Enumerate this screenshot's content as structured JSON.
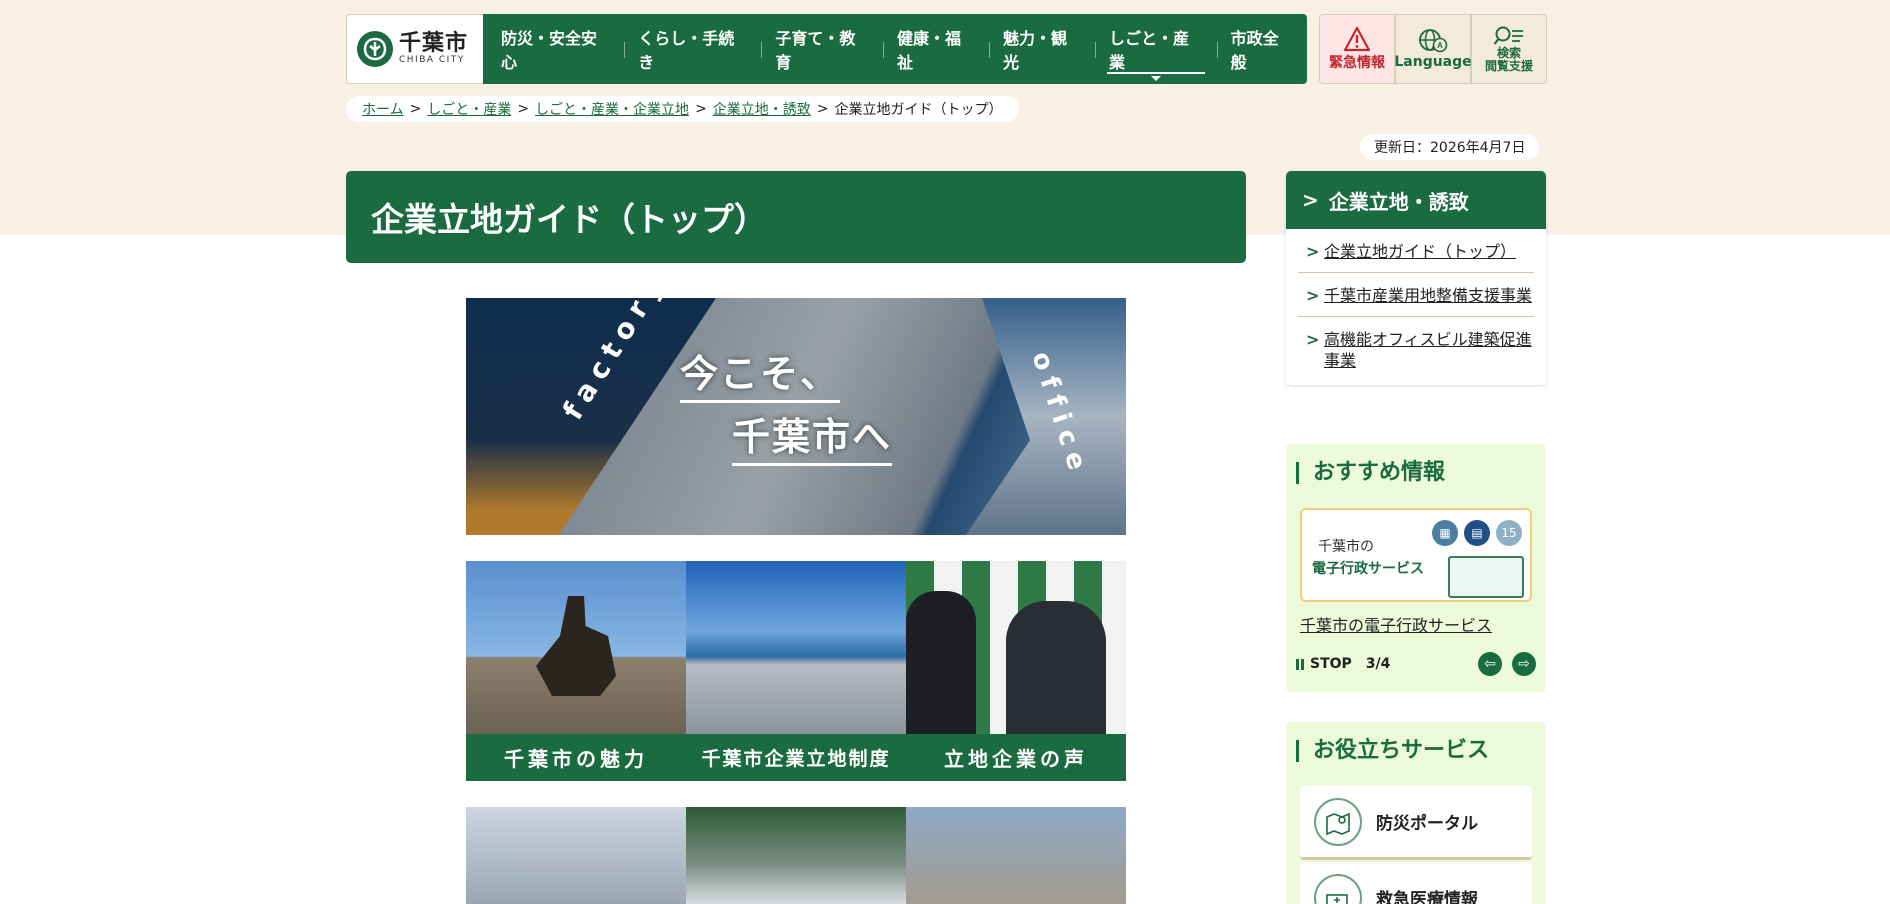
{
  "header": {
    "logo_jp": "千葉市",
    "logo_en": "CHIBA CITY",
    "nav": [
      {
        "label": "防災・安全安心"
      },
      {
        "label": "くらし・手続き"
      },
      {
        "label": "子育て・教育"
      },
      {
        "label": "健康・福祉"
      },
      {
        "label": "魅力・観光"
      },
      {
        "label": "しごと・産業",
        "active": true
      },
      {
        "label": "市政全般"
      }
    ],
    "util": {
      "emergency": "緊急情報",
      "language": "Language",
      "search": "検索\n閲覧支援"
    }
  },
  "breadcrumb": {
    "items": [
      "ホーム",
      "しごと・産業",
      "しごと・産業・企業立地",
      "企業立地・誘致"
    ],
    "current": "企業立地ガイド（トップ）",
    "sep": ">"
  },
  "updated": "更新日：2026年4月7日",
  "page_title": "企業立地ガイド（トップ）",
  "hero": {
    "line1": "今こそ、",
    "line2": "千葉市へ",
    "left_word": "factory",
    "right_word": "office"
  },
  "tiles": [
    {
      "caption": "千葉市の魅力"
    },
    {
      "caption": "千葉市企業立地制度"
    },
    {
      "caption": "立地企業の声"
    }
  ],
  "sidebar": {
    "title": "企業立地・誘致",
    "links": [
      "企業立地ガイド（トップ）",
      "千葉市産業用地整備支援事業",
      "高機能オフィスビル建築促進事業"
    ]
  },
  "recommend": {
    "title": "おすすめ情報",
    "card_line1": "千葉市の",
    "card_line2": "電子行政サービス",
    "card_icon_date": "15",
    "link": "千葉市の電子行政サービス",
    "stop": "STOP",
    "counter": "3/4"
  },
  "useful": {
    "title": "お役立ちサービス",
    "items": [
      "防災ポータル",
      "救急医療情報"
    ]
  },
  "colors": {
    "primary": "#1a6b3f",
    "beige": "#f8f0e3",
    "emergency": "#c1272d",
    "light_green": "#ecfad9"
  }
}
